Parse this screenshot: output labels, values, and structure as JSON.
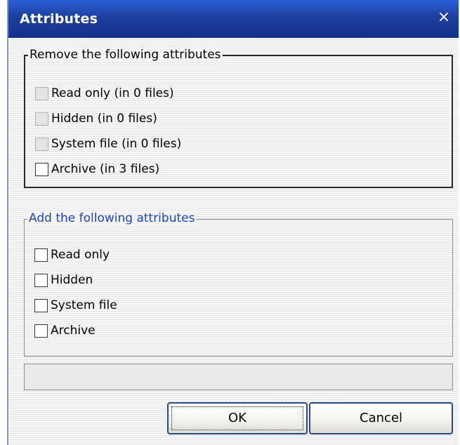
{
  "window": {
    "title": "Attributes",
    "close_glyph": "×"
  },
  "remove_group": {
    "label": "Remove the following attributes",
    "items": [
      {
        "label": "Read only (in 0 files)",
        "checked": false,
        "enabled": false
      },
      {
        "label": "Hidden (in 0 files)",
        "checked": false,
        "enabled": false
      },
      {
        "label": "System file (in 0 files)",
        "checked": false,
        "enabled": false
      },
      {
        "label": "Archive (in 3 files)",
        "checked": false,
        "enabled": true
      }
    ]
  },
  "add_group": {
    "label": "Add the following attributes",
    "items": [
      {
        "label": "Read only",
        "checked": false
      },
      {
        "label": "Hidden",
        "checked": false
      },
      {
        "label": "System file",
        "checked": false
      },
      {
        "label": "Archive",
        "checked": false
      }
    ]
  },
  "progress": {
    "value": 0
  },
  "buttons": {
    "ok": "OK",
    "cancel": "Cancel"
  },
  "colors": {
    "title_bar": "#1d3f9e",
    "add_group_label": "#1c44c8",
    "button_border": "#2b4a83"
  }
}
